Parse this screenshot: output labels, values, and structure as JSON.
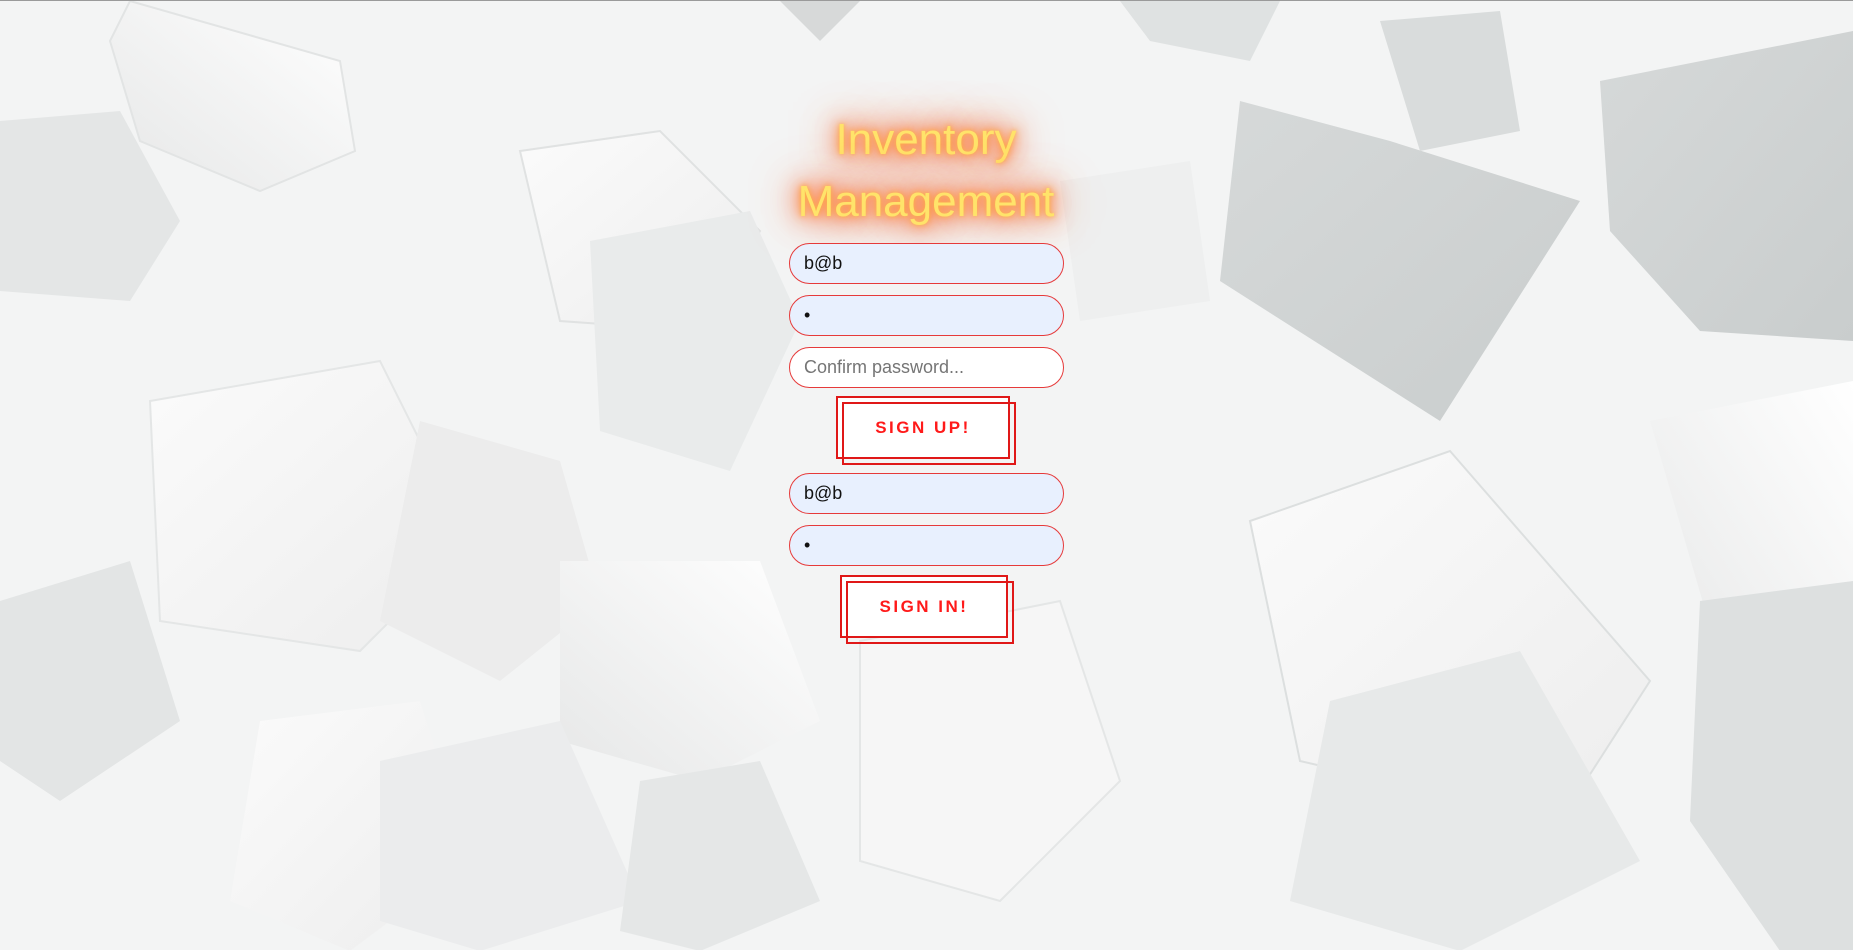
{
  "title": "Inventory Management",
  "signup": {
    "email_value": "b@b",
    "password_value": "•",
    "confirm_placeholder": "Confirm password...",
    "button_label": "SIGN UP!"
  },
  "signin": {
    "email_value": "b@b",
    "password_value": "•",
    "button_label": "SIGN IN!"
  },
  "colors": {
    "accent": "#e01818",
    "title_glow": "#ff6a2f",
    "title_text": "#ffe36a",
    "autofill_bg": "#e8f0fe"
  }
}
